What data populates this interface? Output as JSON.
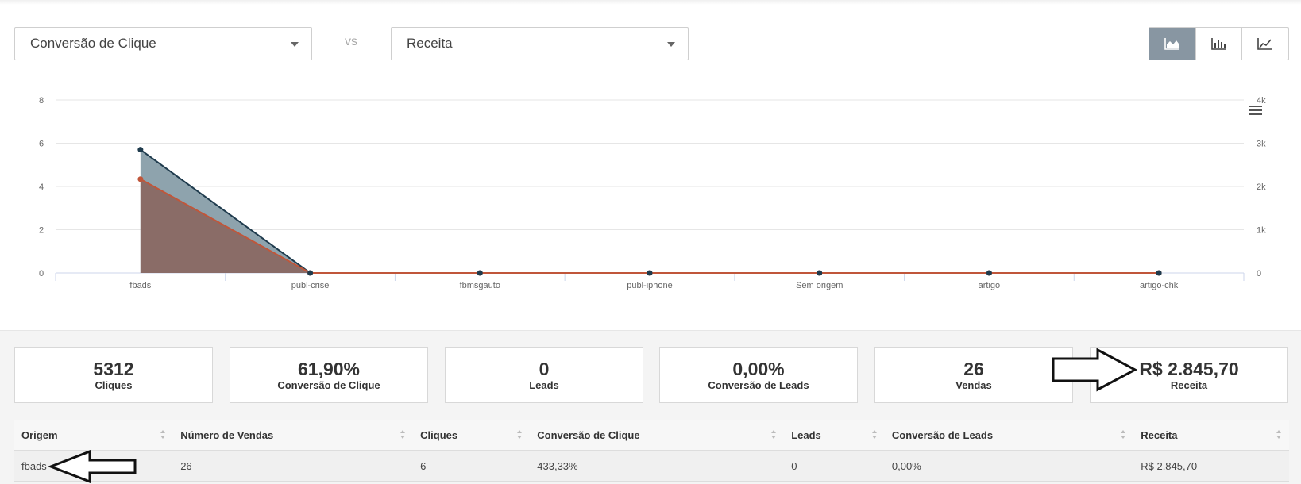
{
  "controls": {
    "metric1": "Conversão de Clique",
    "vs": "vs",
    "metric2": "Receita",
    "chart_types": [
      "area-chart-icon",
      "bar-chart-icon",
      "line-chart-icon"
    ],
    "active_chart_type": "area-chart-icon"
  },
  "chart_data": {
    "type": "area",
    "categories": [
      "fbads",
      "publ-crise",
      "fbmsgauto",
      "publ-iphone",
      "Sem origem",
      "artigo",
      "artigo-chk"
    ],
    "series": [
      {
        "axis": "left",
        "color": "#1f3b4d",
        "fill": "#8ea3ad",
        "values": [
          5.7,
          0,
          0,
          0,
          0,
          0,
          0
        ]
      },
      {
        "axis": "right",
        "color": "#c0563a",
        "fill": "#8a6c67",
        "values": [
          2170,
          0,
          0,
          0,
          0,
          0,
          0
        ]
      }
    ],
    "y_left": {
      "min": 0,
      "max": 8,
      "ticks": [
        "0",
        "2",
        "4",
        "6",
        "8"
      ]
    },
    "y_right": {
      "min": 0,
      "max": 4000,
      "ticks": [
        "0",
        "1k",
        "2k",
        "3k",
        "4k"
      ]
    },
    "grid": true,
    "menu_icon": "hamburger-menu-icon"
  },
  "stats": [
    {
      "value": "5312",
      "label": "Cliques"
    },
    {
      "value": "61,90%",
      "label": "Conversão de Clique"
    },
    {
      "value": "0",
      "label": "Leads"
    },
    {
      "value": "0,00%",
      "label": "Conversão de Leads"
    },
    {
      "value": "26",
      "label": "Vendas"
    },
    {
      "value": "R$ 2.845,70",
      "label": "Receita"
    }
  ],
  "table": {
    "headers": [
      "Origem",
      "Número de Vendas",
      "Cliques",
      "Conversão de Clique",
      "Leads",
      "Conversão de Leads",
      "Receita"
    ],
    "rows": [
      [
        "fbads",
        "26",
        "6",
        "433,33%",
        "0",
        "0,00%",
        "R$ 2.845,70"
      ]
    ]
  }
}
